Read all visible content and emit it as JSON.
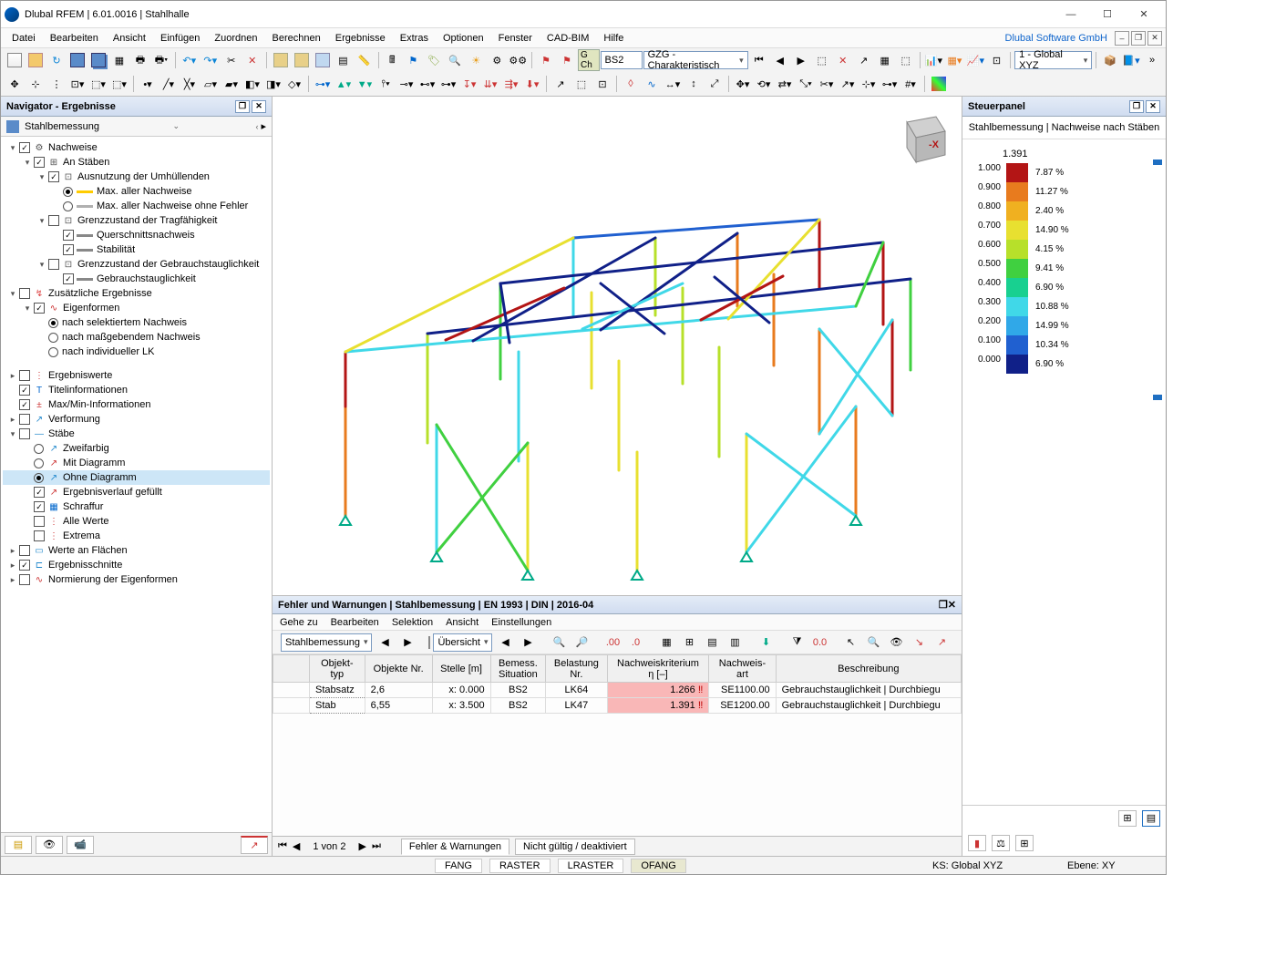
{
  "window": {
    "title": "Dlubal RFEM | 6.01.0016 | Stahlhalle"
  },
  "company": "Dlubal Software GmbH",
  "menu": [
    "Datei",
    "Bearbeiten",
    "Ansicht",
    "Einfügen",
    "Zuordnen",
    "Berechnen",
    "Ergebnisse",
    "Extras",
    "Optionen",
    "Fenster",
    "CAD-BIM",
    "Hilfe"
  ],
  "toolbar": {
    "gch_label": "G Ch",
    "bs_field": "BS2",
    "combo_field": "GZG - Charakteristisch",
    "global_cs": "1 - Global XYZ"
  },
  "navigator": {
    "title": "Navigator - Ergebnisse",
    "subtitle": "Stahlbemessung",
    "tree": [
      {
        "d": 0,
        "tw": "▾",
        "cb": true,
        "ic": "⚙",
        "label": "Nachweise"
      },
      {
        "d": 1,
        "tw": "▾",
        "cb": true,
        "ic": "⊞",
        "label": "An Stäben"
      },
      {
        "d": 2,
        "tw": "▾",
        "cb": true,
        "ic": "⊡",
        "label": "Ausnutzung der Umhüllenden"
      },
      {
        "d": 3,
        "rb": true,
        "swatch": "#ffcc00",
        "label": "Max. aller Nachweise"
      },
      {
        "d": 3,
        "rb": false,
        "swatch": "#b0b0b0",
        "label": "Max. aller Nachweise ohne Fehler"
      },
      {
        "d": 2,
        "tw": "▾",
        "cb": false,
        "ic": "⊡",
        "label": "Grenzzustand der Tragfähigkeit"
      },
      {
        "d": 3,
        "cb": true,
        "swatch": "#888",
        "label": "Querschnittsnachweis"
      },
      {
        "d": 3,
        "cb": true,
        "swatch": "#888",
        "label": "Stabilität"
      },
      {
        "d": 2,
        "tw": "▾",
        "cb": false,
        "ic": "⊡",
        "label": "Grenzzustand der Gebrauchstauglichkeit"
      },
      {
        "d": 3,
        "cb": true,
        "swatch": "#888",
        "label": "Gebrauchstauglichkeit"
      },
      {
        "d": 0,
        "tw": "▾",
        "cb": false,
        "ic": "↯",
        "label": "Zusätzliche Ergebnisse",
        "icColor": "#d44"
      },
      {
        "d": 1,
        "tw": "▾",
        "cb": true,
        "ic": "∿",
        "label": "Eigenformen",
        "icColor": "#c33"
      },
      {
        "d": 2,
        "rb": true,
        "label": "nach selektiertem Nachweis"
      },
      {
        "d": 2,
        "rb": false,
        "label": "nach maßgebendem Nachweis"
      },
      {
        "d": 2,
        "rb": false,
        "label": "nach individueller LK"
      }
    ],
    "tree2": [
      {
        "d": 0,
        "tw": "▸",
        "cb": false,
        "ic": "⋮",
        "label": "Ergebniswerte",
        "icColor": "#c33"
      },
      {
        "d": 0,
        "cb": true,
        "ic": "T",
        "label": "Titelinformationen",
        "icColor": "#06c"
      },
      {
        "d": 0,
        "cb": true,
        "ic": "±",
        "label": "Max/Min-Informationen",
        "icColor": "#c33"
      },
      {
        "d": 0,
        "tw": "▸",
        "cb": false,
        "ic": "↗",
        "label": "Verformung",
        "icColor": "#28c"
      },
      {
        "d": 0,
        "tw": "▾",
        "cb": false,
        "ic": "—",
        "label": "Stäbe",
        "icColor": "#28c"
      },
      {
        "d": 1,
        "rb": false,
        "ic": "↗",
        "label": "Zweifarbig",
        "icColor": "#28c"
      },
      {
        "d": 1,
        "rb": false,
        "ic": "↗",
        "label": "Mit Diagramm",
        "icColor": "#c33"
      },
      {
        "d": 1,
        "rb": true,
        "ic": "↗",
        "label": "Ohne Diagramm",
        "icColor": "#28c",
        "sel": true
      },
      {
        "d": 1,
        "cb": true,
        "ic": "↗",
        "label": "Ergebnisverlauf gefüllt",
        "icColor": "#c33"
      },
      {
        "d": 1,
        "cb": true,
        "ic": "▦",
        "label": "Schraffur",
        "icColor": "#06c"
      },
      {
        "d": 1,
        "cb": false,
        "ic": "⋮",
        "label": "Alle Werte",
        "icColor": "#c33"
      },
      {
        "d": 1,
        "cb": false,
        "ic": "⋮",
        "label": "Extrema",
        "icColor": "#c33"
      },
      {
        "d": 0,
        "tw": "▸",
        "cb": false,
        "ic": "▭",
        "label": "Werte an Flächen",
        "icColor": "#28c"
      },
      {
        "d": 0,
        "tw": "▸",
        "cb": true,
        "ic": "⊏",
        "label": "Ergebnisschnitte",
        "icColor": "#28c"
      },
      {
        "d": 0,
        "tw": "▸",
        "cb": false,
        "ic": "∿",
        "label": "Normierung der Eigenformen",
        "icColor": "#c33"
      }
    ]
  },
  "steuerpanel": {
    "title": "Steuerpanel",
    "subtitle": "Stahlbemessung | Nachweise nach Stäben",
    "max": "1.391",
    "ticks": [
      "1.000",
      "0.900",
      "0.800",
      "0.700",
      "0.600",
      "0.500",
      "0.400",
      "0.300",
      "0.200",
      "0.100",
      "0.000"
    ],
    "colors": [
      "#b31515",
      "#e87b1e",
      "#f0b020",
      "#e8e030",
      "#b7e02a",
      "#40d040",
      "#18d090",
      "#40d8e8",
      "#30a8e8",
      "#2060d0",
      "#102088"
    ],
    "pct": [
      "7.87 %",
      "11.27 %",
      "2.40 %",
      "14.90 %",
      "4.15 %",
      "9.41 %",
      "6.90 %",
      "10.88 %",
      "14.99 %",
      "10.34 %",
      "6.90 %"
    ]
  },
  "errors": {
    "title": "Fehler und Warnungen | Stahlbemessung | EN 1993 | DIN | 2016-04",
    "menu": [
      "Gehe zu",
      "Bearbeiten",
      "Selektion",
      "Ansicht",
      "Einstellungen"
    ],
    "dd1": "Stahlbemessung",
    "dd2": "Übersicht",
    "columns": [
      "Objekt-\ntyp",
      "Objekte Nr.",
      "Stelle [m]",
      "Bemess.\nSituation",
      "Belastung\nNr.",
      "Nachweiskriterium\nη [–]",
      "Nachweis-\nart",
      "Beschreibung"
    ],
    "rows": [
      {
        "typ": "Stabsatz",
        "nr": "2,6",
        "stelle": "x: 0.000",
        "sit": "BS2",
        "bel": "LK64",
        "krit": "1.266",
        "art": "SE1100.00",
        "besch": "Gebrauchstauglichkeit | Durchbiegu"
      },
      {
        "typ": "Stab",
        "nr": "6,55",
        "stelle": "x: 3.500",
        "sit": "BS2",
        "bel": "LK47",
        "krit": "1.391",
        "art": "SE1200.00",
        "besch": "Gebrauchstauglichkeit | Durchbiegu"
      }
    ],
    "pager": "1 von 2",
    "tabs": [
      "Fehler & Warnungen",
      "Nicht gültig / deaktiviert"
    ]
  },
  "statusbar": {
    "snaps": [
      "FANG",
      "RASTER",
      "LRASTER",
      "OFANG"
    ],
    "ks": "KS: Global XYZ",
    "ebene": "Ebene: XY"
  }
}
